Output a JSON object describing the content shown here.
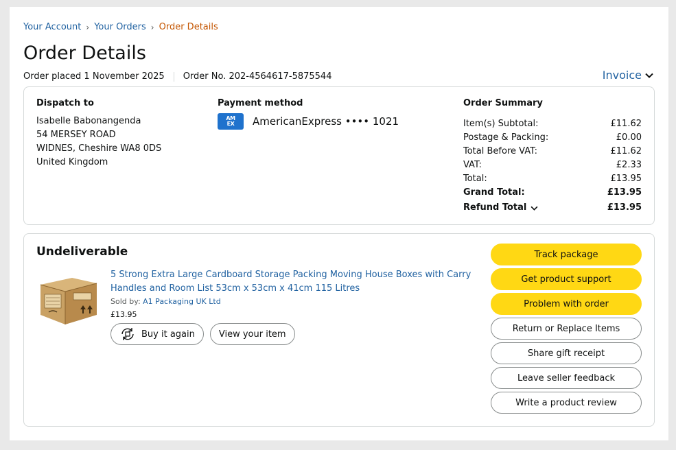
{
  "breadcrumb": {
    "account": "Your Account",
    "orders": "Your Orders",
    "current": "Order Details",
    "sep": "›"
  },
  "page_title": "Order Details",
  "meta": {
    "placed": "Order placed 1 November 2025",
    "order_no": "Order No. 202-4564617-5875544"
  },
  "invoice_label": "Invoice",
  "dispatch": {
    "heading": "Dispatch to",
    "lines": [
      "Isabelle Babonangenda",
      "54 MERSEY ROAD",
      "WIDNES, Cheshire WA8 0DS",
      "United Kingdom"
    ]
  },
  "payment": {
    "heading": "Payment method",
    "card_text": "AmericanExpress •••• 1021",
    "card_badge_line1": "AM",
    "card_badge_line2": "EX",
    "card_color": "#1f72cd"
  },
  "summary": {
    "heading": "Order Summary",
    "rows": [
      {
        "label": "Item(s) Subtotal:",
        "value": "£11.62"
      },
      {
        "label": "Postage & Packing:",
        "value": "£0.00"
      },
      {
        "label": "Total Before VAT:",
        "value": "£11.62"
      },
      {
        "label": "VAT:",
        "value": "£2.33"
      },
      {
        "label": "Total:",
        "value": "£13.95"
      }
    ],
    "grand_total_label": "Grand Total:",
    "grand_total_value": "£13.95",
    "refund_total_label": "Refund Total",
    "refund_total_value": "£13.95"
  },
  "shipment": {
    "status": "Undeliverable",
    "product_title": "5 Strong Extra Large Cardboard Storage Packing Moving House Boxes with Carry Handles and Room List 53cm x 53cm x 41cm 115 Litres",
    "sold_by_label": "Sold by:",
    "seller": "A1 Packaging UK Ltd",
    "price": "£13.95",
    "buy_again": "Buy it again",
    "view_item": "View your item"
  },
  "actions": {
    "track": "Track package",
    "support": "Get product support",
    "problem": "Problem with order",
    "return": "Return or Replace Items",
    "gift": "Share gift receipt",
    "feedback": "Leave seller feedback",
    "review": "Write a product review"
  },
  "colors": {
    "link": "#2162a1",
    "accent_orange": "#c45500",
    "primary_button": "#ffd814"
  }
}
